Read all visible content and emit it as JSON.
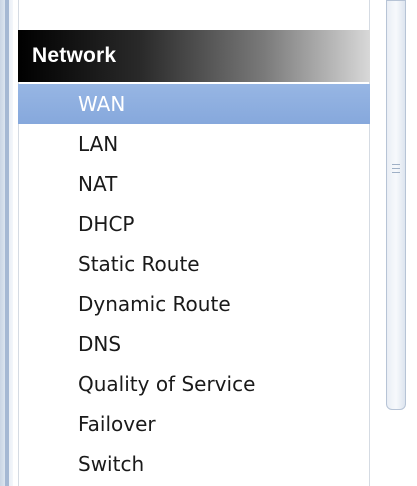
{
  "menu": {
    "section_title": "Network",
    "items": [
      {
        "label": "WAN",
        "selected": true
      },
      {
        "label": "LAN",
        "selected": false
      },
      {
        "label": "NAT",
        "selected": false
      },
      {
        "label": "DHCP",
        "selected": false
      },
      {
        "label": "Static Route",
        "selected": false
      },
      {
        "label": "Dynamic Route",
        "selected": false
      },
      {
        "label": "DNS",
        "selected": false
      },
      {
        "label": "Quality of Service",
        "selected": false
      },
      {
        "label": "Failover",
        "selected": false
      },
      {
        "label": "Switch",
        "selected": false
      }
    ]
  },
  "colors": {
    "selected_bg": "#8fb0e0",
    "header_bg_start": "#000000",
    "header_bg_end": "#d8d8d8",
    "scroll_thumb": "#e9eef5"
  }
}
